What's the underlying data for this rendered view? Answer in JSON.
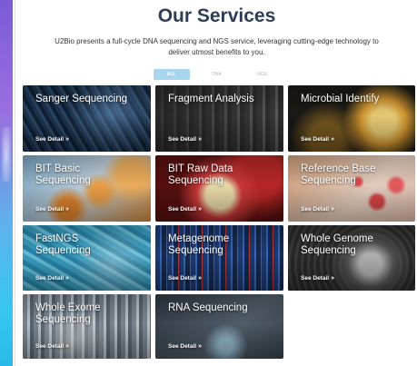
{
  "header": {
    "title": "Our Services",
    "subtitle": "U2Bio presents a full-cycle DNA sequencing and NGS service, leveraging cutting-edge technology to deliver utmost benefits to you."
  },
  "tabs": [
    {
      "label": "ALL",
      "active": true
    },
    {
      "label": "DNA",
      "active": false
    },
    {
      "label": "NGS",
      "active": false
    }
  ],
  "detail_label": "See Detail",
  "services": [
    {
      "name": "Sanger Sequencing",
      "detail": "See Detail"
    },
    {
      "name": "Fragment Analysis",
      "detail": "See Detail"
    },
    {
      "name": "Microbial Identify",
      "detail": "See Detail"
    },
    {
      "name": "BIT Basic Sequencing",
      "detail": "See Detail"
    },
    {
      "name": "BIT Raw Data Sequencing",
      "detail": "See Detail"
    },
    {
      "name": "Reference Base Sequencing",
      "detail": "See Detail"
    },
    {
      "name": "FastNGS Sequencing",
      "detail": "See Detail"
    },
    {
      "name": "Metagenome Sequencing",
      "detail": "See Detail"
    },
    {
      "name": "Whole Genome Sequencing",
      "detail": "See Detail"
    },
    {
      "name": "Whole Exome Sequencing",
      "detail": "See Detail"
    },
    {
      "name": "RNA Sequencing",
      "detail": "See Detail"
    }
  ],
  "colors": {
    "title": "#2c3e57",
    "active_tab": "#a8d6ee",
    "inactive_tab_text": "#a9b7c8"
  }
}
